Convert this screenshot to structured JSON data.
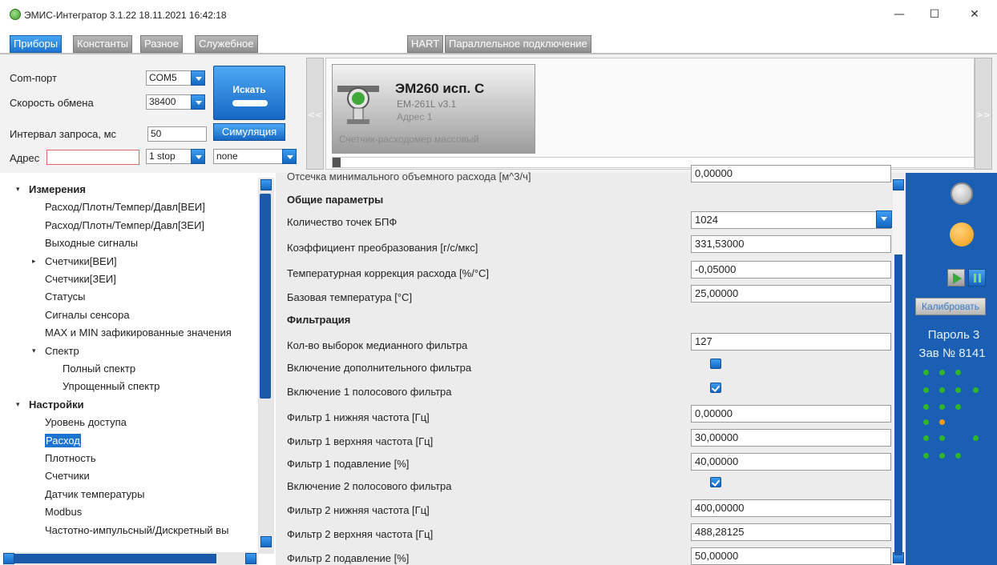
{
  "window": {
    "title": "ЭМИС-Интегратор 3.1.22 18.11.2021 16:42:18",
    "minimize": "—",
    "maximize": "☐",
    "close": "✕"
  },
  "tabs": {
    "left": [
      "Приборы",
      "Константы",
      "Разное",
      "Служебное"
    ],
    "active_index": 0,
    "right": [
      "HART",
      "Параллельное подключение"
    ]
  },
  "connection": {
    "com_port_label": "Com-порт",
    "com_port_value": "COM5",
    "baud_label": "Скорость обмена",
    "baud_value": "38400",
    "interval_label": "Интервал запроса, мс",
    "interval_value": "50",
    "address_label": "Адрес",
    "address_value": "",
    "stop_bits_value": "1 stop",
    "parity_value": "none",
    "search_button": "Искать",
    "simulation_button": "Симуляция"
  },
  "carousel": {
    "prev": "<<",
    "next": ">>",
    "device": {
      "name": "ЭМ260 исп. С",
      "model": "EM-261L v3.1",
      "address": "Адрес 1",
      "description": "Счетчик-расходомер массовый"
    }
  },
  "tree": {
    "items": [
      {
        "label": "Измерения",
        "level": 0,
        "group": true,
        "expander": "▾"
      },
      {
        "label": "Расход/Плотн/Темпер/Давл[ВЕИ]",
        "level": 1
      },
      {
        "label": "Расход/Плотн/Темпер/Давл[ЗЕИ]",
        "level": 1
      },
      {
        "label": "Выходные сигналы",
        "level": 1
      },
      {
        "label": "Счетчики[ВЕИ]",
        "level": 1,
        "expander": "▸"
      },
      {
        "label": "Счетчики[ЗЕИ]",
        "level": 1
      },
      {
        "label": "Статусы",
        "level": 1
      },
      {
        "label": "Сигналы сенсора",
        "level": 1
      },
      {
        "label": "MAX и MIN зафикированные значения",
        "level": 1
      },
      {
        "label": "Спектр",
        "level": 1,
        "expander": "▾"
      },
      {
        "label": "Полный спектр",
        "level": 2
      },
      {
        "label": "Упрощенный спектр",
        "level": 2
      },
      {
        "label": "Настройки",
        "level": 0,
        "group": true,
        "expander": "▾"
      },
      {
        "label": "Уровень доступа",
        "level": 1
      },
      {
        "label": "Расход",
        "level": 1,
        "selected": true
      },
      {
        "label": "Плотность",
        "level": 1
      },
      {
        "label": "Счетчики",
        "level": 1
      },
      {
        "label": "Датчик температуры",
        "level": 1
      },
      {
        "label": "Modbus",
        "level": 1
      },
      {
        "label": "Частотно-импульсный/Дискретный вы",
        "level": 1
      }
    ]
  },
  "params": {
    "cut_row": {
      "label": "Отсечка минимального объемного расхода [м^3/ч]",
      "value": "0,00000"
    },
    "section_general": "Общие параметры",
    "fft_points": {
      "label": "Количество точек БПФ",
      "value": "1024"
    },
    "conversion_coef": {
      "label": "Коэффициент преобразования [г/с/мкс]",
      "value": "331,53000"
    },
    "temp_correction": {
      "label": "Температурная коррекция расхода [%/°С]",
      "value": "-0,05000"
    },
    "base_temp": {
      "label": "Базовая температура [°С]",
      "value": "25,00000"
    },
    "section_filter": "Фильтрация",
    "median_samples": {
      "label": "Кол-во выборок медианного фильтра",
      "value": "127"
    },
    "extra_filter": {
      "label": "Включение дополнительного фильтра",
      "checked": false
    },
    "band1_enable": {
      "label": "Включение 1 полосового фильтра",
      "checked": true
    },
    "f1_low": {
      "label": "Фильтр 1 нижняя частота [Гц]",
      "value": "0,00000"
    },
    "f1_high": {
      "label": "Фильтр 1 верхняя частота [Гц]",
      "value": "30,00000"
    },
    "f1_suppress": {
      "label": "Фильтр 1 подавление [%]",
      "value": "40,00000"
    },
    "band2_enable": {
      "label": "Включение 2 полосового фильтра",
      "checked": true
    },
    "f2_low": {
      "label": "Фильтр 2 нижняя частота [Гц]",
      "value": "400,00000"
    },
    "f2_high": {
      "label": "Фильтр 2 верхняя частота [Гц]",
      "value": "488,28125"
    },
    "f2_suppress": {
      "label": "Фильтр 2 подавление [%]",
      "value": "50,00000"
    }
  },
  "status": {
    "calibrate_button": "Калибровать",
    "password": "Пароль 3",
    "serial": "Зав № 8141",
    "colors": {
      "led_off": "#bdbdbd",
      "led_active": "#f8a31a",
      "dot_green": "#31b52a",
      "dot_orange": "#f19a16",
      "panel": "#1a5fb4"
    }
  }
}
